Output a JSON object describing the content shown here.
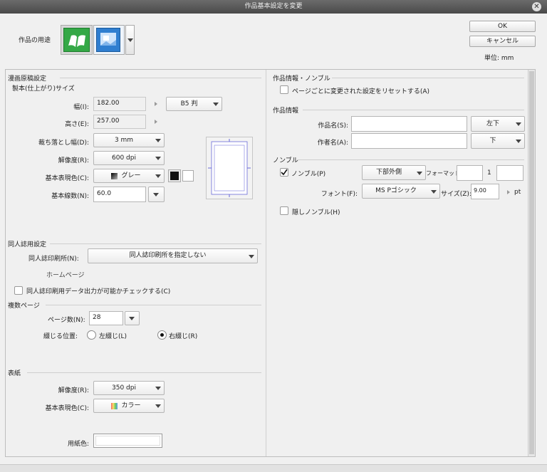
{
  "window": {
    "title": "作品基本設定を変更"
  },
  "header": {
    "purpose_label": "作品の用途",
    "ok": "OK",
    "cancel": "キャンセル",
    "unit": "単位: mm"
  },
  "manga": {
    "heading": "漫画原稿設定",
    "bound_size": "製本(仕上がり)サイズ",
    "width_label": "幅(I):",
    "width_value": "182.00",
    "size_preset": "B5 判",
    "height_label": "高さ(E):",
    "height_value": "257.00",
    "bleed_label": "裁ち落とし幅(D):",
    "bleed_value": "3 mm",
    "res_label": "解像度(R):",
    "res_value": "600 dpi",
    "color_label": "基本表現色(C):",
    "color_value": "グレー",
    "lines_label": "基本線数(N):",
    "lines_value": "60.0"
  },
  "doujin": {
    "heading": "同人誌用設定",
    "printer_label": "同人誌印刷所(N):",
    "printer_value": "同人誌印刷所を指定しない",
    "homepage": "ホームページ",
    "check_label": "同人誌印刷用データ出力が可能かチェックする(C)"
  },
  "pages": {
    "heading": "複数ページ",
    "count_label": "ページ数(N):",
    "count_value": "28",
    "binding_label": "綴じる位置:",
    "left": "左綴じ(L)",
    "right": "右綴じ(R)"
  },
  "cover": {
    "heading": "表紙",
    "res_label": "解像度(R):",
    "res_value": "350 dpi",
    "color_label": "基本表現色(C):",
    "color_value": "カラー",
    "paper_label": "用紙色:"
  },
  "work_nombre": {
    "heading": "作品情報・ノンブル",
    "reset_label": "ページごとに変更された設定をリセットする(A)"
  },
  "work_info": {
    "heading": "作品情報",
    "title_label": "作品名(S):",
    "title_pos": "左下",
    "author_label": "作者名(A):",
    "author_pos": "下"
  },
  "nombre": {
    "heading": "ノンブル",
    "enable_label": "ノンブル(P)",
    "position": "下部外側",
    "format_label": "フォーマット:",
    "format_value": "1",
    "font_label": "フォント(F):",
    "font_value": "MS Pゴシック",
    "size_label": "サイズ(Z):",
    "size_value": "9.00",
    "size_unit": "pt",
    "hidden_label": "隠しノンブル(H)"
  },
  "colors": {
    "accent_green": "#34a846",
    "accent_blue": "#2f7ed0"
  }
}
